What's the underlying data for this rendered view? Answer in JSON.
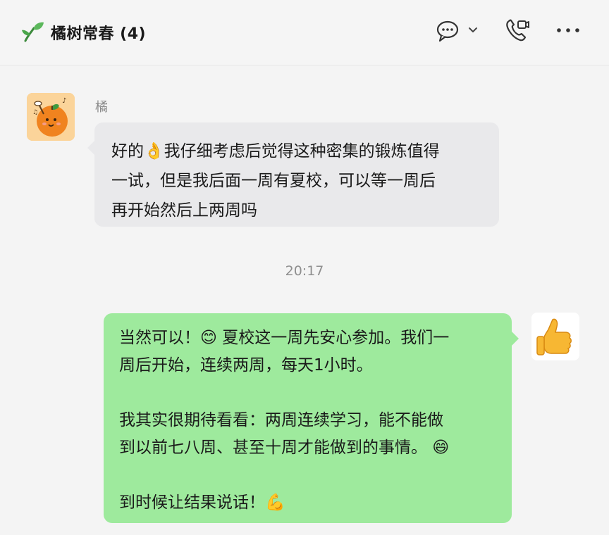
{
  "header": {
    "sprout_emoji": "🌱",
    "title": "橘树常春 (4)",
    "icons": [
      "chat-bubble-icon",
      "chevron-down-icon",
      "video-call-icon",
      "more-icon"
    ]
  },
  "messages": {
    "incoming": {
      "sender": "橘",
      "lines": [
        "好的👌我仔细考虑后觉得这种密集的锻炼值得",
        "一试，但是我后面一周有夏校，可以等一周后",
        "再开始然后上两周吗"
      ],
      "avatar_icon": "orange-mascot-icon"
    },
    "timestamp": "20:17",
    "outgoing": {
      "avatar_emoji": "👍",
      "p1": [
        "当然可以！😊 夏校这一周先安心参加。我们一",
        "周后开始，连续两周，每天1小时。"
      ],
      "p2": [
        "我其实很期待看看：两周连续学习，能不能做",
        "到以前七八周、甚至十周才能做到的事情。 😄"
      ],
      "p3": [
        "到时候让结果说话！💪"
      ]
    }
  },
  "colors": {
    "incoming_bubble": "#e9e9eb",
    "outgoing_bubble": "#9eea9d",
    "background": "#f4f4f4"
  }
}
